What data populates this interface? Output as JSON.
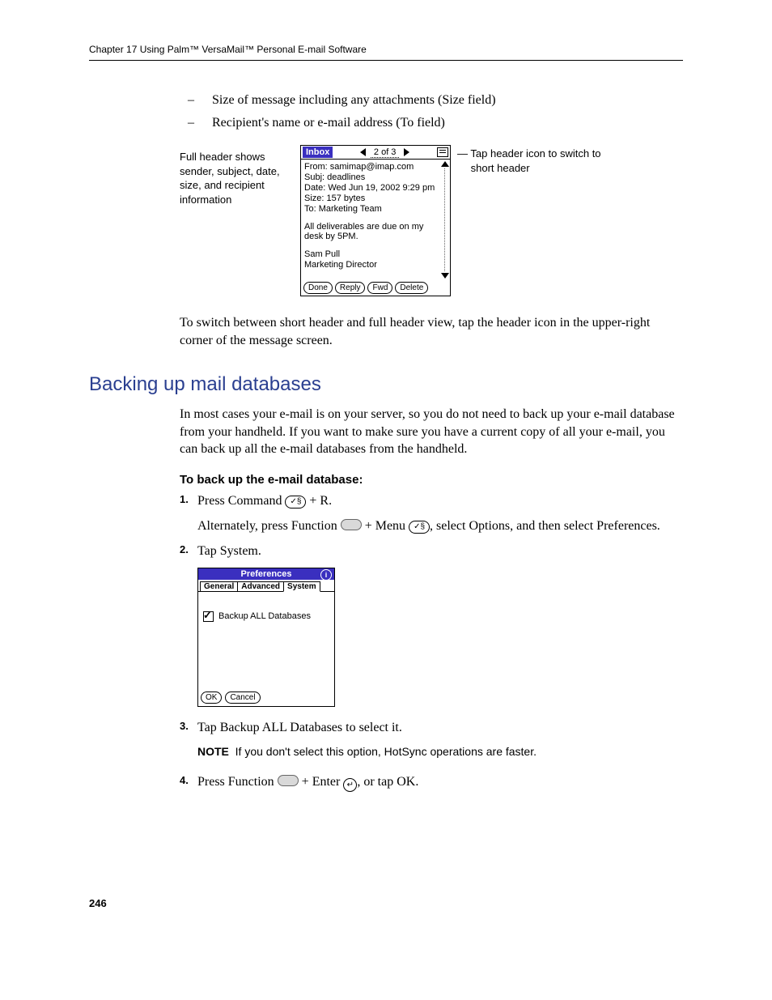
{
  "header": "Chapter 17   Using Palm™ VersaMail™ Personal E-mail Software",
  "bullets": {
    "b1": "Size of message including any attachments (Size field)",
    "b2": "Recipient's name or e-mail address (To field)"
  },
  "fig1": {
    "left_caption": "Full header shows sender, subject, date, size, and recipient information",
    "right_caption_line1": "Tap header icon to switch to",
    "right_caption_line2": "short header",
    "palm": {
      "title": "Inbox",
      "count": "2 of 3",
      "from": "From:  samimap@imap.com",
      "subj": "Subj:  deadlines",
      "date": "Date:  Wed Jun 19, 2002 9:29 pm",
      "size": "Size:  157 bytes",
      "to": "    To:  Marketing Team",
      "msg1": "All deliverables are due on my desk by 5PM.",
      "sig1": "Sam Pull",
      "sig2": "Marketing Director",
      "btn_done": "Done",
      "btn_reply": "Reply",
      "btn_fwd": "Fwd",
      "btn_delete": "Delete"
    }
  },
  "para1": "To switch between short header and full header view, tap the header icon in the upper-right corner of the message screen.",
  "section_heading": "Backing up mail databases",
  "para2": "In most cases your e-mail is on your server, so you do not need to back up your e-mail database from your handheld. If you want to make sure you have a current copy of all your e-mail, you can back up all the e-mail databases from the handheld.",
  "subhead": "To back up the e-mail database:",
  "steps": {
    "s1": {
      "num": "1.",
      "t1a": "Press Command ",
      "key1": "✓§",
      "t1b": " + R.",
      "t2a": "Alternately, press Function ",
      "t2b": " + Menu ",
      "key2": "✓§",
      "t2c": ", select Options, and then select Preferences."
    },
    "s2": {
      "num": "2.",
      "text": "Tap System."
    },
    "s3": {
      "num": "3.",
      "text": "Tap Backup ALL Databases to select it."
    },
    "s4": {
      "num": "4.",
      "t1a": "Press Function ",
      "t1b": " + Enter ",
      "enter": "↵",
      "t1c": ", or tap OK."
    }
  },
  "prefs": {
    "title": "Preferences",
    "info": "i",
    "tab1": "General",
    "tab2": "Advanced",
    "tab3": "System",
    "check_label": "Backup ALL Databases",
    "ok": "OK",
    "cancel": "Cancel"
  },
  "note": {
    "label": "NOTE",
    "text": "If you don't select this option, HotSync operations are faster."
  },
  "page_number": "246"
}
